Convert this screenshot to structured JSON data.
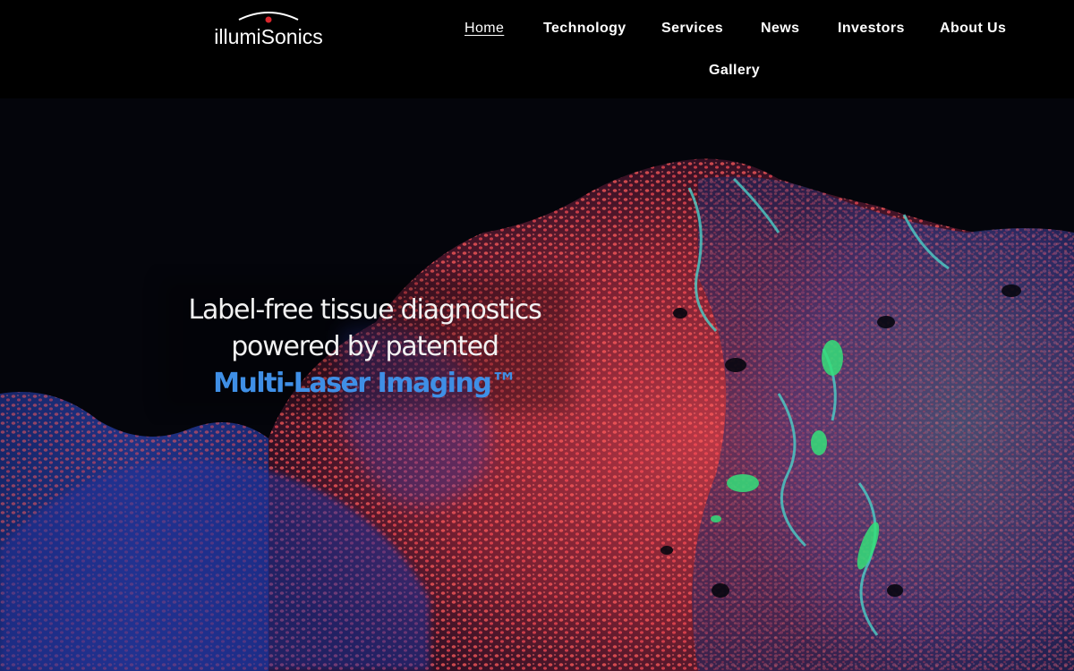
{
  "brand": {
    "name": "illumiSonics",
    "dot_color": "#d9262c"
  },
  "nav": {
    "items": [
      {
        "label": "Home",
        "active": true
      },
      {
        "label": "Technology",
        "active": false
      },
      {
        "label": "Services",
        "active": false
      },
      {
        "label": "News",
        "active": false
      },
      {
        "label": "Investors",
        "active": false
      },
      {
        "label": "About Us",
        "active": false
      },
      {
        "label": "Gallery",
        "active": false
      }
    ]
  },
  "hero": {
    "line1": "Label-free tissue diagnostics",
    "line2": "powered by patented",
    "line3": "Multi-Laser Imaging™",
    "accent_color": "#3f8fe6",
    "background_image": "fluorescence-tissue-micrograph"
  }
}
